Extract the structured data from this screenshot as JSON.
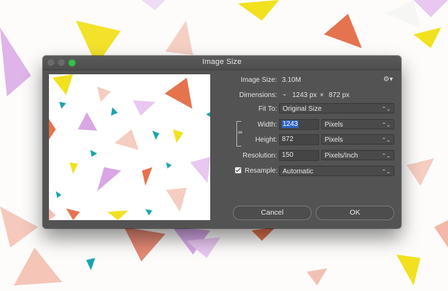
{
  "window": {
    "title": "Image Size"
  },
  "colors": {
    "accent": "#2f65c4",
    "dialog_bg": "#535353",
    "maximize": "#35c24a"
  },
  "icons": {
    "settings": "gear-icon",
    "link": "chain-link-icon",
    "dimensions_toggle": "chevron-down-icon"
  },
  "image_size": {
    "label": "Image Size:",
    "value": "3.10M"
  },
  "dimensions": {
    "label": "Dimensions:",
    "width": "1243 px",
    "times": "×",
    "height": "872 px"
  },
  "fit_to": {
    "label": "Fit To:",
    "value": "Original Size"
  },
  "width": {
    "label": "Width:",
    "value": "1243",
    "unit": "Pixels"
  },
  "height": {
    "label": "Height:",
    "value": "872",
    "unit": "Pixels"
  },
  "resolution": {
    "label": "Resolution:",
    "value": "150",
    "unit": "Pixels/Inch"
  },
  "resample": {
    "label": "Resample:",
    "value": "Automatic",
    "checked": true
  },
  "buttons": {
    "cancel": "Cancel",
    "ok": "OK"
  }
}
